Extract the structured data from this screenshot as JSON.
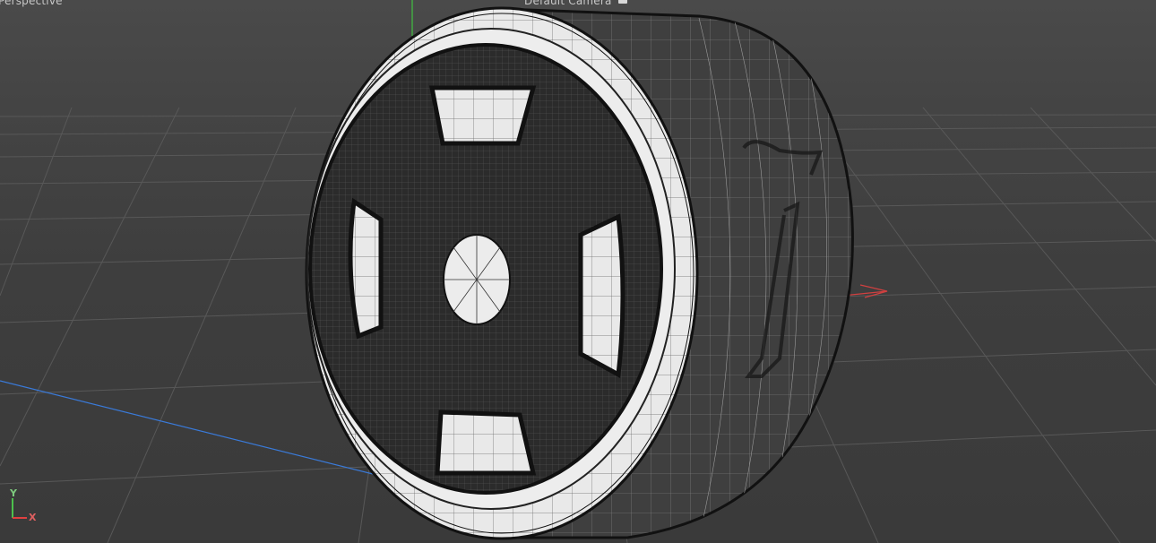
{
  "viewport": {
    "view_name": "Perspective",
    "camera_name": "Default Camera",
    "camera_icon": "camera-icon",
    "axis_gizmo": {
      "y_label": "Y",
      "x_label": "X"
    }
  },
  "scene": {
    "object": "wheel-mesh",
    "decal_digit": "7",
    "colors": {
      "background": "#3b3b3b",
      "grid": "#555555",
      "mesh_dark": "#2a2a2a",
      "mesh_light": "#e8e8e8",
      "axis_x": "#e04040",
      "axis_y": "#40c040",
      "axis_z": "#3a7ad8"
    }
  }
}
